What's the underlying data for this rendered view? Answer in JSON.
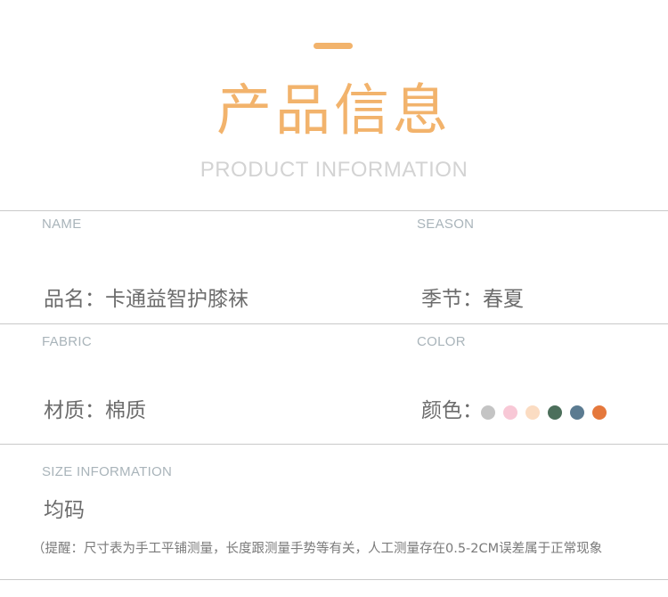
{
  "header": {
    "title": "产品信息",
    "subtitle": "PRODUCT INFORMATION",
    "accent_color": "#f2b36c"
  },
  "fields": {
    "name": {
      "label": "NAME",
      "value": "品名：卡通益智护膝袜"
    },
    "season": {
      "label": "SEASON",
      "value": "季节：春夏"
    },
    "fabric": {
      "label": "FABRIC",
      "value": "材质：棉质"
    },
    "color": {
      "label": "COLOR",
      "value": "颜色：",
      "swatches": [
        "#c4c4c4",
        "#f8c8d6",
        "#fbdcc2",
        "#4c6f5b",
        "#5b7b91",
        "#e5783c"
      ]
    },
    "size": {
      "label": "SIZE INFORMATION",
      "value": "均码"
    }
  },
  "note": "（提醒：尺寸表为手工平铺测量，长度跟测量手势等有关，人工测量存在0.5-2CM误差属于正常现象"
}
